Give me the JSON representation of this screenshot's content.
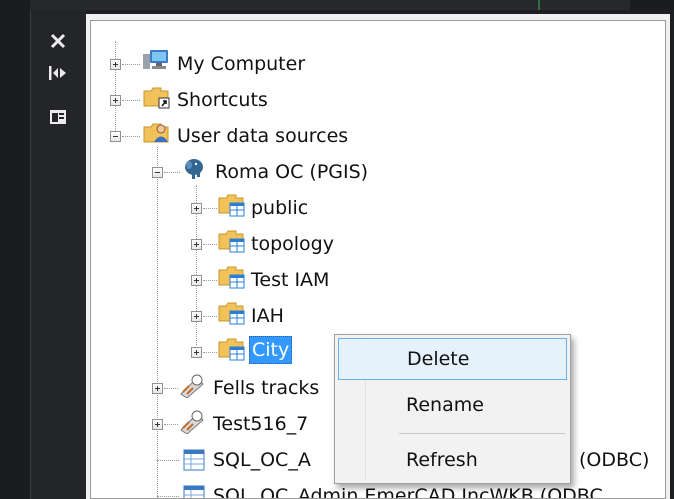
{
  "toolbar": {
    "close_glyph": "✕",
    "icons": [
      "close-icon",
      "auto-hide-icon",
      "properties-icon"
    ]
  },
  "tree": {
    "nodes": [
      {
        "label": "My Computer",
        "icon": "computer-icon"
      },
      {
        "label": "Shortcuts",
        "icon": "folder-shortcut-icon"
      },
      {
        "label": "User data sources",
        "icon": "folder-user-icon"
      },
      {
        "label": "Roma OC (PGIS)",
        "icon": "postgis-elephant-icon"
      },
      {
        "label": "public",
        "icon": "schema-folder-icon"
      },
      {
        "label": "topology",
        "icon": "schema-folder-icon"
      },
      {
        "label": "Test IAM",
        "icon": "schema-folder-icon"
      },
      {
        "label": "IAH",
        "icon": "schema-folder-icon"
      },
      {
        "label": "City",
        "icon": "schema-folder-icon",
        "selected": true
      },
      {
        "label": "Fells tracks",
        "icon": "gps-track-icon"
      },
      {
        "label": "Test516_7",
        "icon": "gps-track-icon"
      },
      {
        "label": "SQL_OC_A",
        "icon": "table-icon",
        "suffix": "(ODBC)"
      },
      {
        "label": "SQL_OC_Admin EmerCAD IncWKB (ODBC",
        "icon": "table-icon"
      }
    ]
  },
  "context_menu": {
    "items": [
      {
        "label": "Delete",
        "highlighted": true
      },
      {
        "label": "Rename"
      },
      {
        "label": "Refresh"
      }
    ]
  },
  "colors": {
    "selection": "#3399ff",
    "menu_hover": "#e5f1fb",
    "menu_hover_border": "#6bb0e8",
    "dark_bg": "#1e1f22"
  }
}
